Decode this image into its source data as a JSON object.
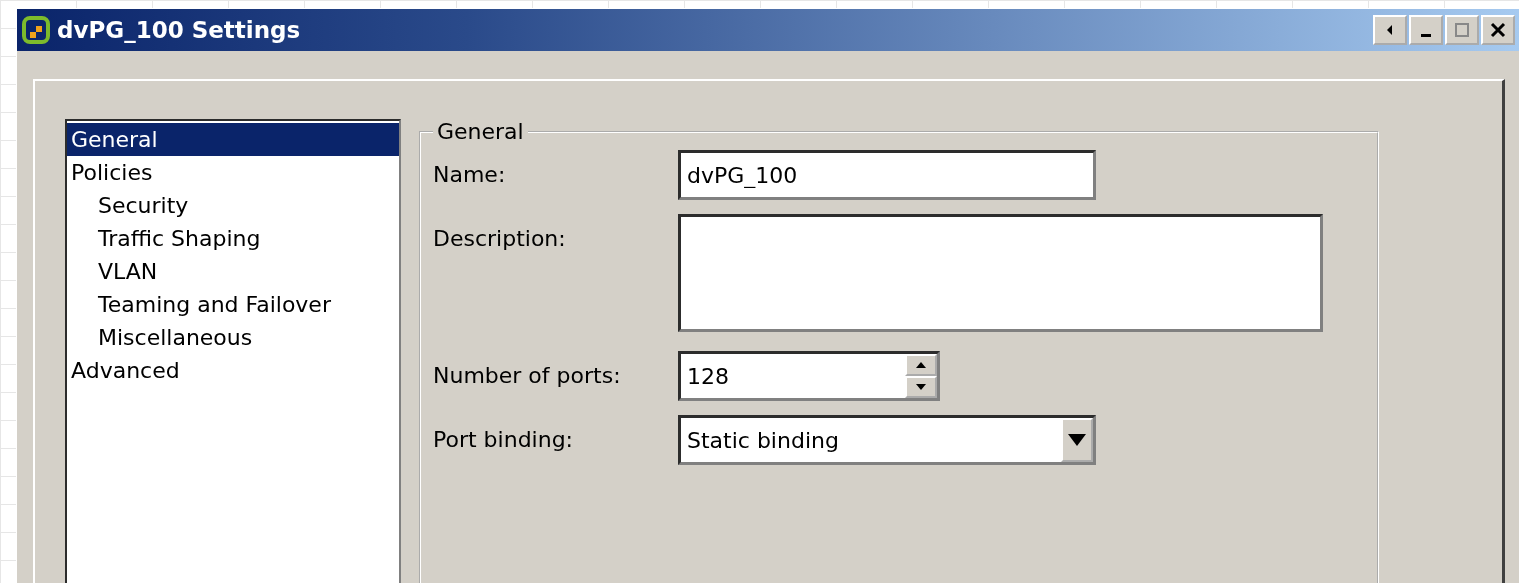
{
  "window": {
    "title": "dvPG_100 Settings"
  },
  "sidebar": {
    "items": [
      {
        "label": "General",
        "selected": true
      },
      {
        "label": "Policies",
        "selected": false,
        "children": [
          {
            "label": "Security",
            "selected": false
          },
          {
            "label": "Traffic Shaping",
            "selected": false
          },
          {
            "label": "VLAN",
            "selected": false
          },
          {
            "label": "Teaming and Failover",
            "selected": false
          },
          {
            "label": "Miscellaneous",
            "selected": false
          }
        ]
      },
      {
        "label": "Advanced",
        "selected": false
      }
    ]
  },
  "group": {
    "title": "General",
    "fields": [
      {
        "kind": "text",
        "label": "Name:",
        "value": "dvPG_100"
      },
      {
        "kind": "textarea",
        "label": "Description:"
      },
      {
        "kind": "spinner",
        "label": "Number of ports:",
        "value": "128"
      },
      {
        "kind": "dropdown",
        "label": "Port binding:",
        "value": "Static binding"
      }
    ]
  }
}
